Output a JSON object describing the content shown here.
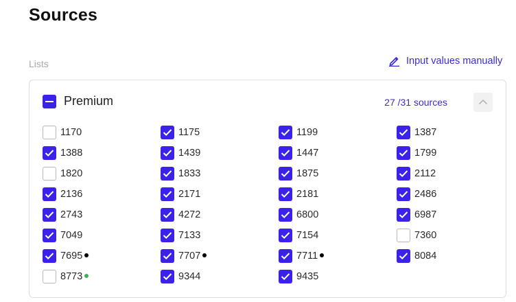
{
  "header": {
    "title": "Sources"
  },
  "lists_label": "Lists",
  "manual_link": {
    "label": "Input values manually",
    "icon": "pencil-icon"
  },
  "colors": {
    "accent": "#3a22e8",
    "link": "#3a2bd6",
    "dot_black": "#000000",
    "dot_green": "#3cb35a"
  },
  "panel": {
    "title": "Premium",
    "count_text": "27 /31  sources",
    "collapse_icon": "chevron-up-icon",
    "items": [
      {
        "label": "1170",
        "checked": false
      },
      {
        "label": "1175",
        "checked": true
      },
      {
        "label": "1199",
        "checked": true
      },
      {
        "label": "1387",
        "checked": true
      },
      {
        "label": "1388",
        "checked": true
      },
      {
        "label": "1439",
        "checked": true
      },
      {
        "label": "1447",
        "checked": true
      },
      {
        "label": "1799",
        "checked": true
      },
      {
        "label": "1820",
        "checked": false
      },
      {
        "label": "1833",
        "checked": true
      },
      {
        "label": "1875",
        "checked": true
      },
      {
        "label": "2112",
        "checked": true
      },
      {
        "label": "2136",
        "checked": true
      },
      {
        "label": "2171",
        "checked": true
      },
      {
        "label": "2181",
        "checked": true
      },
      {
        "label": "2486",
        "checked": true
      },
      {
        "label": "2743",
        "checked": true
      },
      {
        "label": "4272",
        "checked": true
      },
      {
        "label": "6800",
        "checked": true
      },
      {
        "label": "6987",
        "checked": true
      },
      {
        "label": "7049",
        "checked": true
      },
      {
        "label": "7133",
        "checked": true
      },
      {
        "label": "7154",
        "checked": true
      },
      {
        "label": "7360",
        "checked": false
      },
      {
        "label": "7695",
        "checked": true,
        "dot": "black"
      },
      {
        "label": "7707",
        "checked": true,
        "dot": "black"
      },
      {
        "label": "7711",
        "checked": true,
        "dot": "black"
      },
      {
        "label": "8084",
        "checked": true
      },
      {
        "label": "8773",
        "checked": false,
        "dot": "green"
      },
      {
        "label": "9344",
        "checked": true
      },
      {
        "label": "9435",
        "checked": true
      }
    ]
  }
}
